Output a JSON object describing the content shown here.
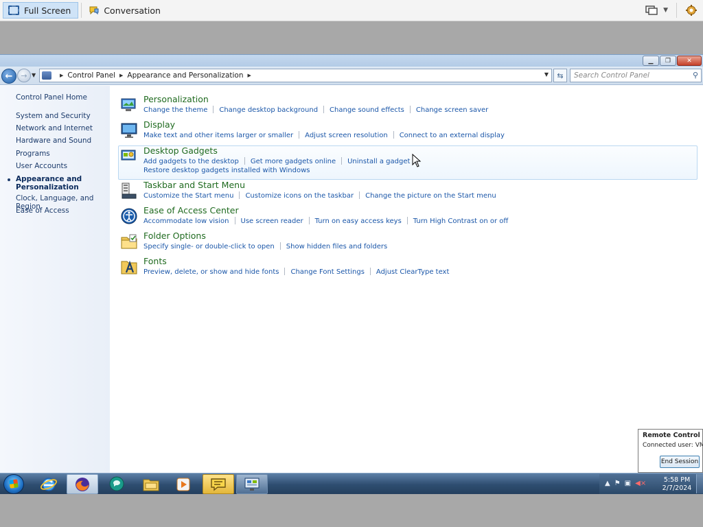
{
  "viewer": {
    "full_screen_label": "Full Screen",
    "conversation_label": "Conversation"
  },
  "window": {
    "breadcrumbs": [
      "Control Panel",
      "Appearance and Personalization"
    ],
    "search_placeholder": "Search Control Panel"
  },
  "sidebar": {
    "home": "Control Panel Home",
    "items": [
      {
        "label": "System and Security"
      },
      {
        "label": "Network and Internet"
      },
      {
        "label": "Hardware and Sound"
      },
      {
        "label": "Programs"
      },
      {
        "label": "User Accounts"
      },
      {
        "label": "Appearance and Personalization",
        "current": true
      },
      {
        "label": "Clock, Language, and Region"
      },
      {
        "label": "Ease of Access"
      }
    ]
  },
  "categories": [
    {
      "title": "Personalization",
      "icon": "personalization-icon",
      "links": [
        "Change the theme",
        "Change desktop background",
        "Change sound effects",
        "Change screen saver"
      ]
    },
    {
      "title": "Display",
      "icon": "display-icon",
      "links": [
        "Make text and other items larger or smaller",
        "Adjust screen resolution",
        "Connect to an external display"
      ]
    },
    {
      "title": "Desktop Gadgets",
      "icon": "gadgets-icon",
      "links": [
        "Add gadgets to the desktop",
        "Get more gadgets online",
        "Uninstall a gadget"
      ],
      "links2": [
        "Restore desktop gadgets installed with Windows"
      ]
    },
    {
      "title": "Taskbar and Start Menu",
      "icon": "taskbar-icon",
      "links": [
        "Customize the Start menu",
        "Customize icons on the taskbar",
        "Change the picture on the Start menu"
      ]
    },
    {
      "title": "Ease of Access Center",
      "icon": "ease-of-access-icon",
      "links": [
        "Accommodate low vision",
        "Use screen reader",
        "Turn on easy access keys",
        "Turn High Contrast on or off"
      ]
    },
    {
      "title": "Folder Options",
      "icon": "folder-options-icon",
      "links": [
        "Specify single- or double-click to open",
        "Show hidden files and folders"
      ]
    },
    {
      "title": "Fonts",
      "icon": "fonts-icon",
      "links": [
        "Preview, delete, or show and hide fonts",
        "Change Font Settings",
        "Adjust ClearType text"
      ]
    }
  ],
  "remote_control": {
    "title": "Remote Control",
    "connected_user": "Connected user: VMS",
    "end_session_label": "End Session"
  },
  "taskbar": {
    "time": "5:58 PM",
    "date": "2/7/2024"
  },
  "colors": {
    "category_title": "#1f6a1f",
    "link": "#1a56a8",
    "sidebar_link": "#1c3b6b"
  }
}
